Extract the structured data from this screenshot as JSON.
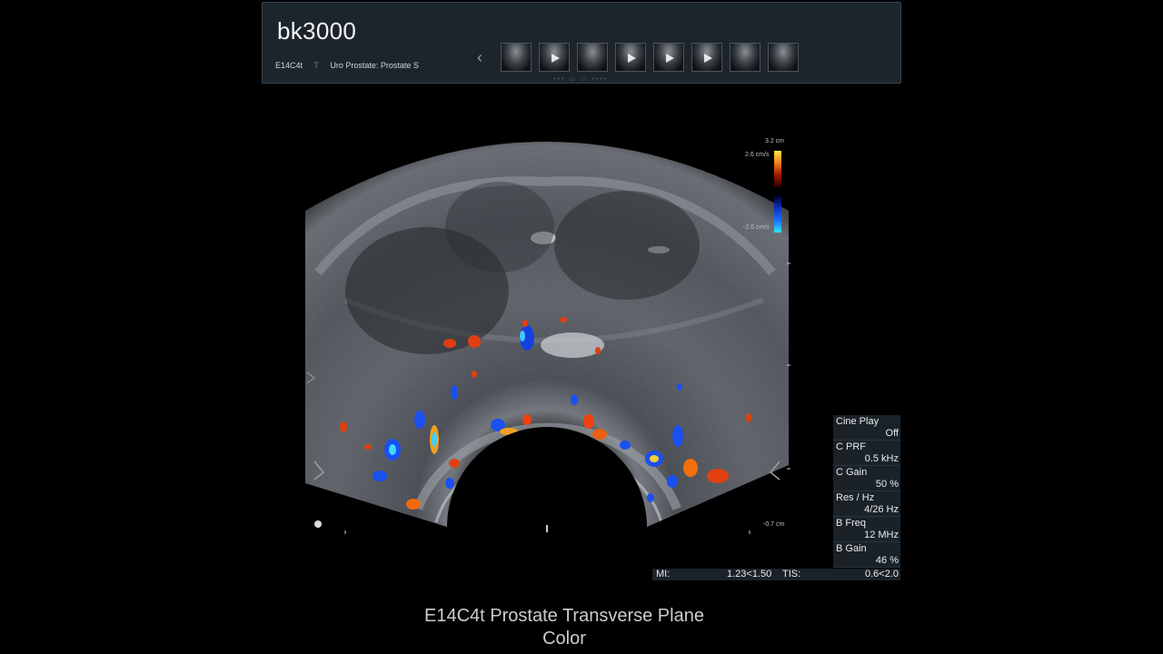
{
  "header": {
    "brand": "bk3000",
    "transducer": "E14C4t",
    "plane": "T",
    "preset": "Uro Prostate: Prostate S",
    "thumbnail_count": 8
  },
  "scale": {
    "depth_top": "3.2 cm",
    "pos_velocity": "2.6 cm/s",
    "neg_velocity": "-2.6 cm/s",
    "depth_bottom": "-0.7 cm"
  },
  "params": [
    {
      "label": "Cine Play",
      "value": "Off"
    },
    {
      "label": "C PRF",
      "value": "0.5 kHz"
    },
    {
      "label": "C Gain",
      "value": "50 %"
    },
    {
      "label": "Res / Hz",
      "value": "4/26 Hz"
    },
    {
      "label": "B Freq",
      "value": "12 MHz"
    },
    {
      "label": "B Gain",
      "value": "46 %"
    }
  ],
  "mi_bar": {
    "mi_label": "MI:",
    "mi_value": "1.23<1.50",
    "tis_label": "TIS:",
    "tis_value": "0.6<2.0"
  },
  "caption": {
    "line1": "E14C4t Prostate Transverse Plane",
    "line2": "Color"
  }
}
